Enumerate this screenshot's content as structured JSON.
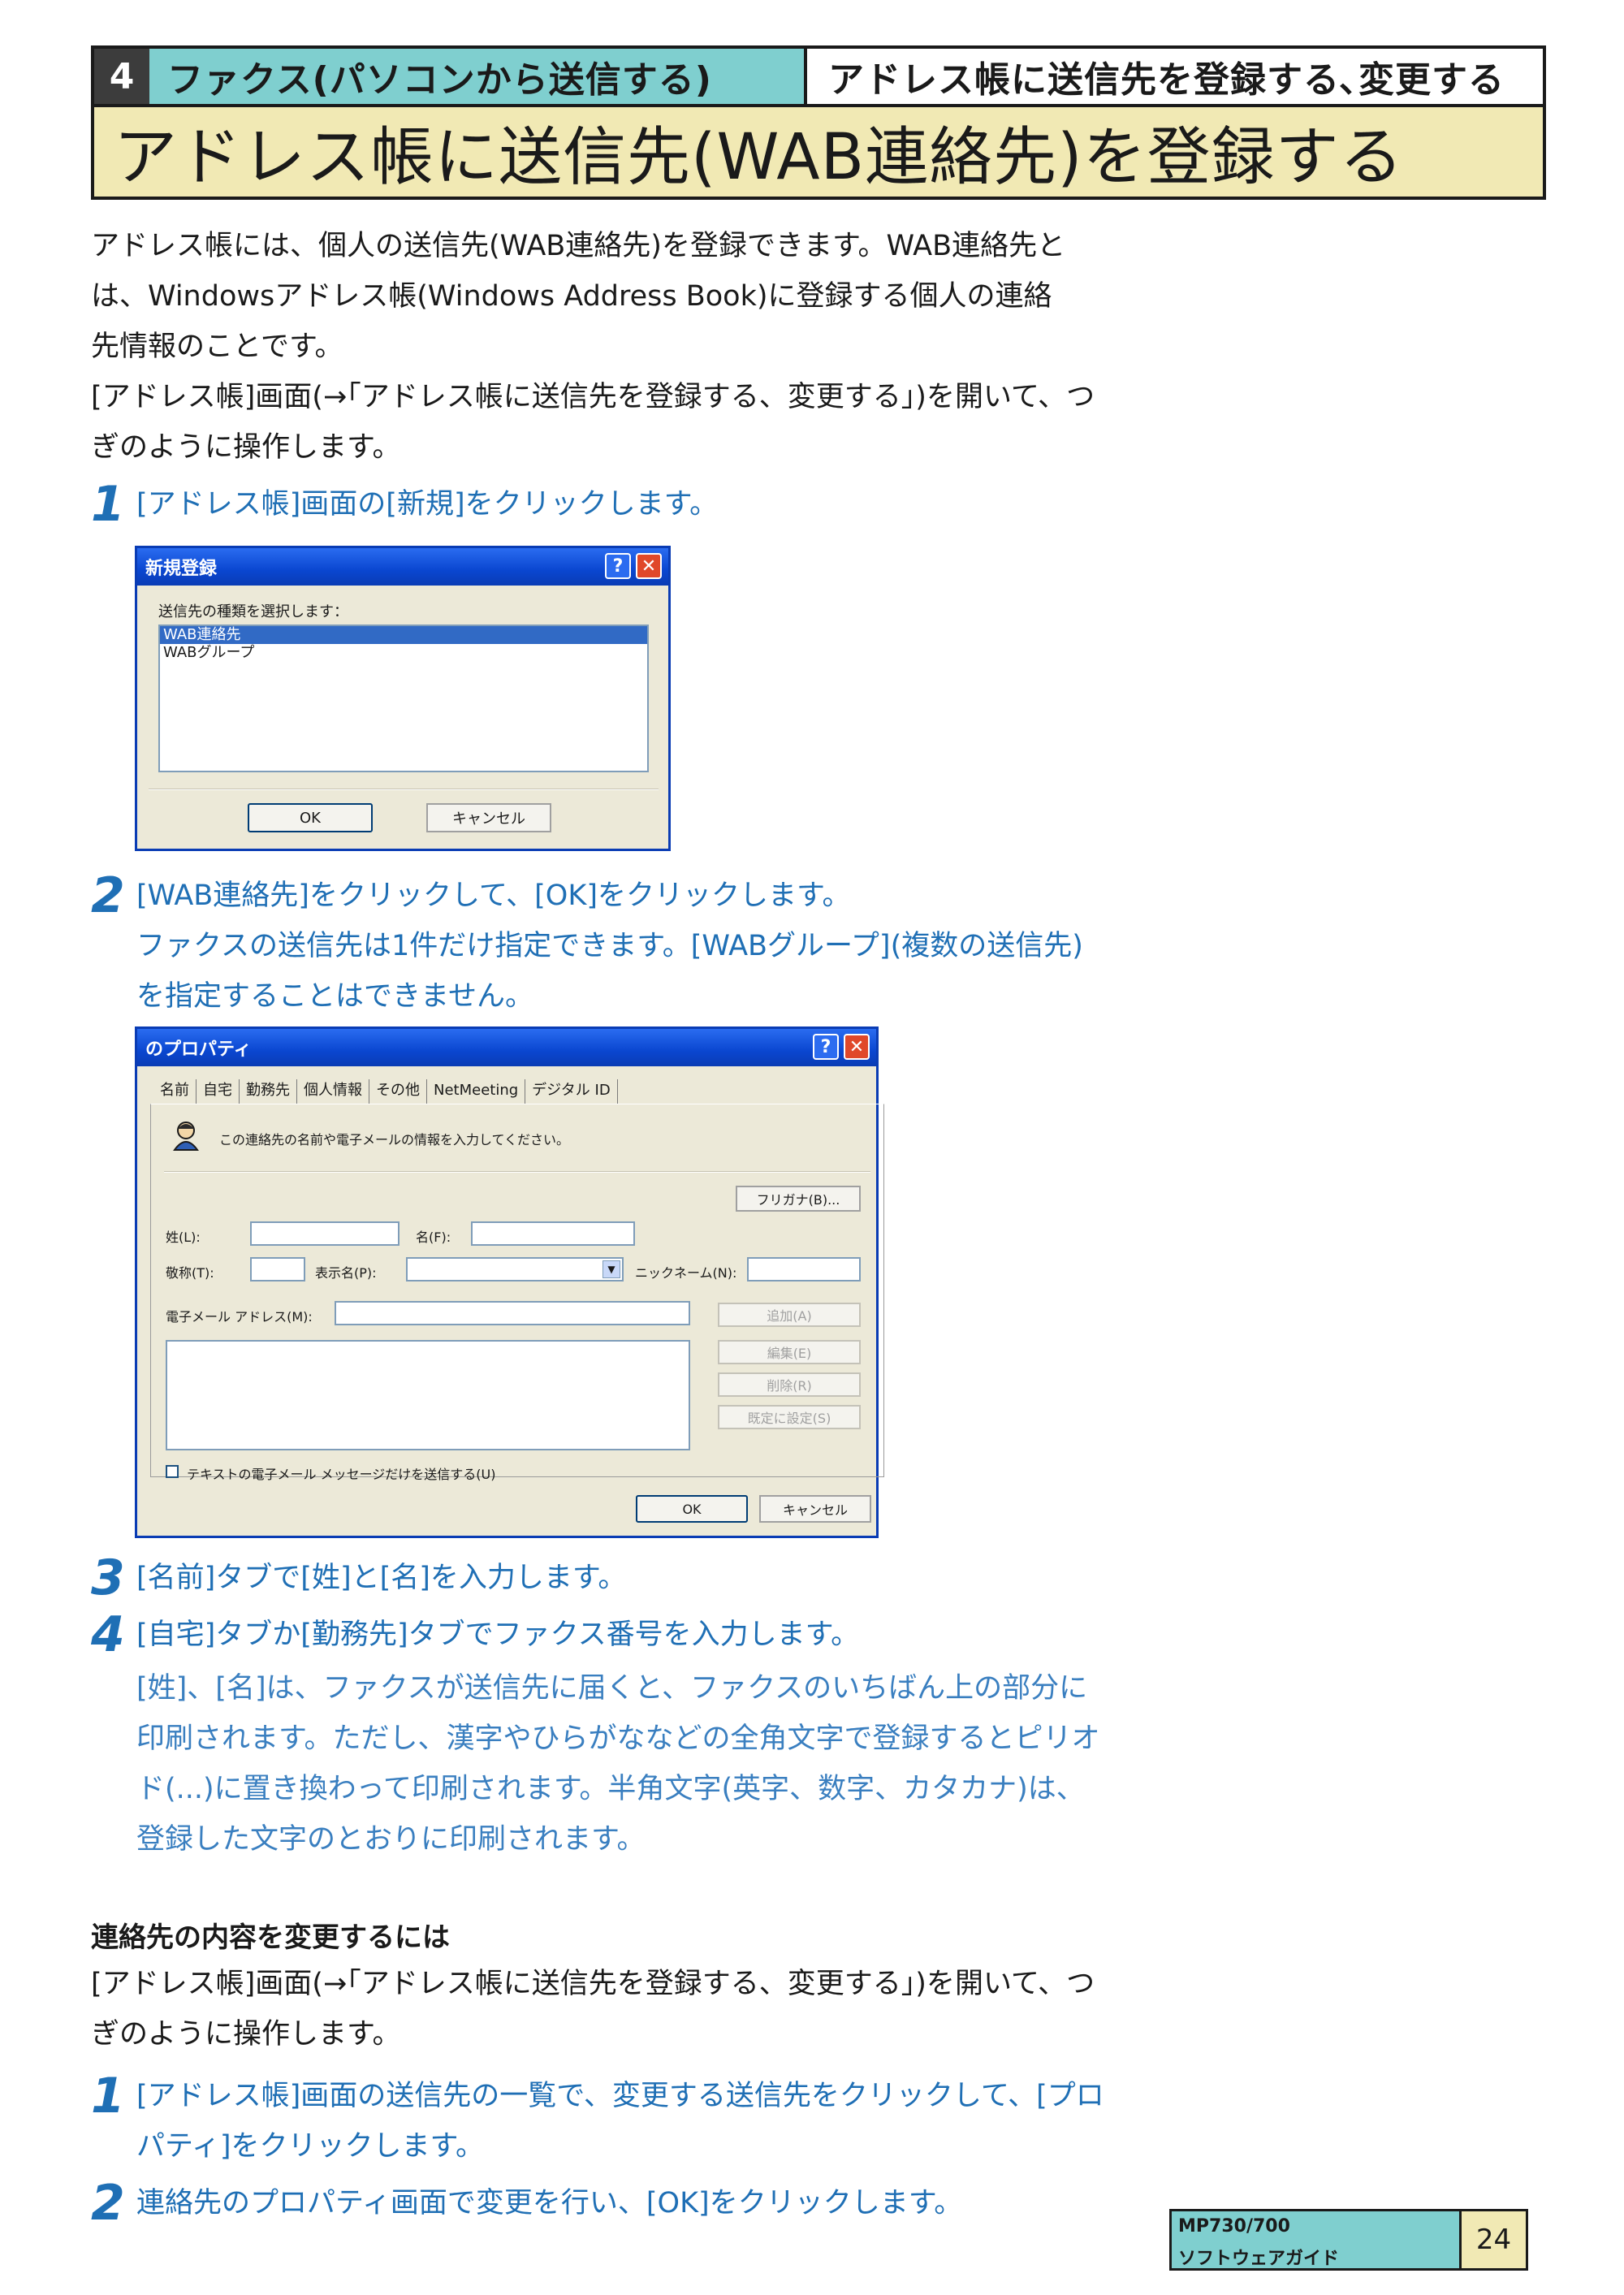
{
  "header": {
    "chapter_number": "4",
    "section": "ファクス(パソコンから送信する)",
    "subsection": "アドレス帳に送信先を登録する､変更する",
    "title": "アドレス帳に送信先(WAB連絡先)を登録する"
  },
  "intro": {
    "line1": "アドレス帳には、個人の送信先(WAB連絡先)を登録できます。WAB連絡先と",
    "line2": "は、Windowsアドレス帳(Windows Address Book)に登録する個人の連絡",
    "line3": "先情報のことです。",
    "line4": "[アドレス帳]画面(→｢アドレス帳に送信先を登録する、変更する｣)を開いて、つ",
    "line5": "ぎのように操作します。"
  },
  "steps": [
    {
      "num": "1",
      "text": "[アドレス帳]画面の[新規]をクリックします。"
    },
    {
      "num": "2",
      "text": "[WAB連絡先]をクリックして、[OK]をクリックします。",
      "note1": "ファクスの送信先は1件だけ指定できます。[WABグループ](複数の送信先)",
      "note2": "を指定することはできません。"
    },
    {
      "num": "3",
      "text": "[名前]タブで[姓]と[名]を入力します。"
    },
    {
      "num": "4",
      "text": "[自宅]タブか[勤務先]タブでファクス番号を入力します。",
      "note1": "[姓]、[名]は、ファクスが送信先に届くと、ファクスのいちばん上の部分に",
      "note2": "印刷されます。ただし、漢字やひらがななどの全角文字で登録するとピリオ",
      "note3": "ド(...)に置き換わって印刷されます。半角文字(英字、数字、カタカナ)は、",
      "note4": "登録した文字のとおりに印刷されます。"
    }
  ],
  "dialog_new": {
    "title": "新規登録",
    "help_btn": "?",
    "close_btn": "✕",
    "prompt": "送信先の種類を選択します：",
    "options": [
      "WAB連絡先",
      "WABグループ"
    ],
    "ok": "OK",
    "cancel": "キャンセル"
  },
  "dialog_props": {
    "title": "のプロパティ",
    "help_btn": "?",
    "close_btn": "✕",
    "tabs": [
      "名前",
      "自宅",
      "勤務先",
      "個人情報",
      "その他",
      "NetMeeting",
      "デジタル ID"
    ],
    "info": "この連絡先の名前や電子メールの情報を入力してください。",
    "furigana_btn": "フリガナ(B)...",
    "last_name": "姓(L):",
    "first_name": "名(F):",
    "title_label": "敬称(T):",
    "display_name": "表示名(P):",
    "nickname": "ニックネーム(N):",
    "email": "電子メール アドレス(M):",
    "add_btn": "追加(A)",
    "edit_btn": "編集(E)",
    "delete_btn": "削除(R)",
    "default_btn": "既定に設定(S)",
    "text_only": "テキストの電子メール メッセージだけを送信する(U)",
    "ok": "OK",
    "cancel": "キャンセル"
  },
  "change_section": {
    "heading": "連絡先の内容を変更するには",
    "line1": "[アドレス帳]画面(→｢アドレス帳に送信先を登録する、変更する｣)を開いて、つ",
    "line2": "ぎのように操作します。",
    "steps": [
      {
        "num": "1",
        "line1": "[アドレス帳]画面の送信先の一覧で、変更する送信先をクリックして、[プロ",
        "line2": "パティ]をクリックします。"
      },
      {
        "num": "2",
        "line1": "連絡先のプロパティ画面で変更を行い、[OK]をクリックします。"
      }
    ]
  },
  "footer": {
    "model": "MP730/700",
    "guide": "ソフトウェアガイド",
    "page": "24"
  },
  "colors": {
    "section_teal": "#7fcfcf",
    "title_cream": "#f1e9b4",
    "step_blue": "#1f6fb5",
    "note_blue": "#3a7fc0",
    "xp_titlebar": "#0a46d0"
  }
}
